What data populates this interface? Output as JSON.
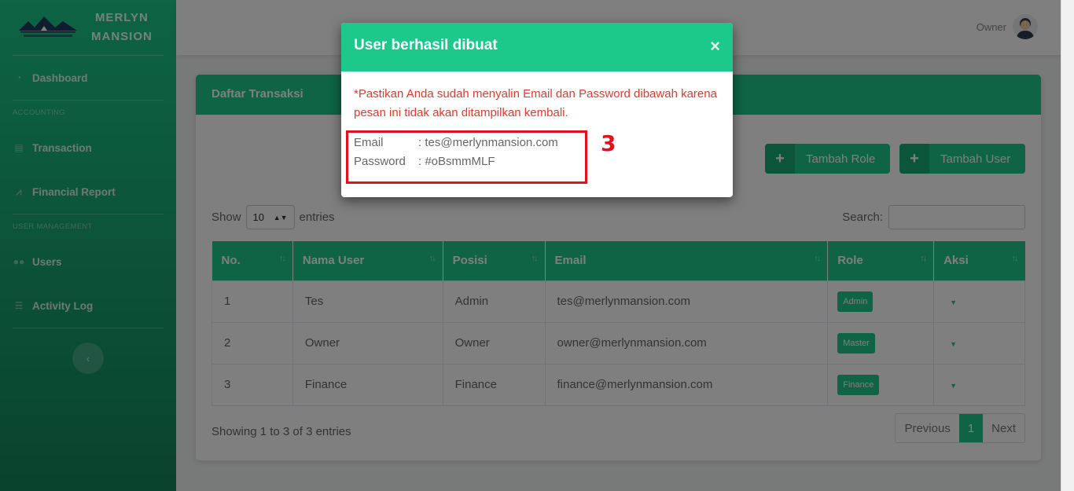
{
  "brand": {
    "name_line1": "MERLYN",
    "name_line2": "MANSION"
  },
  "sidebar": {
    "items": [
      {
        "label": "Dashboard",
        "icon": "dashboard-icon"
      },
      {
        "heading": "ACCOUNTING"
      },
      {
        "label": "Transaction",
        "icon": "receipt-icon"
      },
      {
        "label": "Financial Report",
        "icon": "chart-icon"
      },
      {
        "heading": "USER MANAGEMENT"
      },
      {
        "label": "Users",
        "icon": "users-icon"
      },
      {
        "label": "Activity Log",
        "icon": "list-icon"
      }
    ],
    "headings": {
      "accounting": "ACCOUNTING",
      "user_management": "USER MANAGEMENT"
    },
    "labels": {
      "dashboard": "Dashboard",
      "transaction": "Transaction",
      "financial_report": "Financial Report",
      "users": "Users",
      "activity_log": "Activity Log"
    },
    "toggle_icon": "‹"
  },
  "topbar": {
    "user_name": "Owner"
  },
  "card": {
    "title": "Daftar Transaksi",
    "buttons": {
      "add_role": "Tambah Role",
      "add_user": "Tambah User",
      "plus": "+"
    },
    "show": "Show",
    "entries_value": "10",
    "entries": "entries",
    "search_label": "Search:",
    "columns": [
      "No.",
      "Nama User",
      "Posisi",
      "Email",
      "Role",
      "Aksi"
    ],
    "rows": [
      {
        "no": "1",
        "name": "Tes",
        "position": "Admin",
        "email": "tes@merlynmansion.com",
        "role": "Admin"
      },
      {
        "no": "2",
        "name": "Owner",
        "position": "Owner",
        "email": "owner@merlynmansion.com",
        "role": "Master"
      },
      {
        "no": "3",
        "name": "Finance",
        "position": "Finance",
        "email": "finance@merlynmansion.com",
        "role": "Finance"
      }
    ],
    "info": "Showing 1 to 3 of 3 entries",
    "pager": {
      "previous": "Previous",
      "page": "1",
      "next": "Next"
    }
  },
  "modal": {
    "title": "User berhasil dibuat",
    "close": "×",
    "warning": "*Pastikan Anda sudah menyalin Email dan Password dibawah karena pesan ini tidak akan ditampilkan kembali.",
    "email_label": "Email",
    "email_value": ": tes@merlynmansion.com",
    "password_label": "Password",
    "password_value": ": #oBsmmMLF"
  },
  "annotation": {
    "step": "3"
  },
  "colors": {
    "accent": "#1cc88a",
    "warning": "#e33a2e",
    "highlight": "#e0121b"
  }
}
